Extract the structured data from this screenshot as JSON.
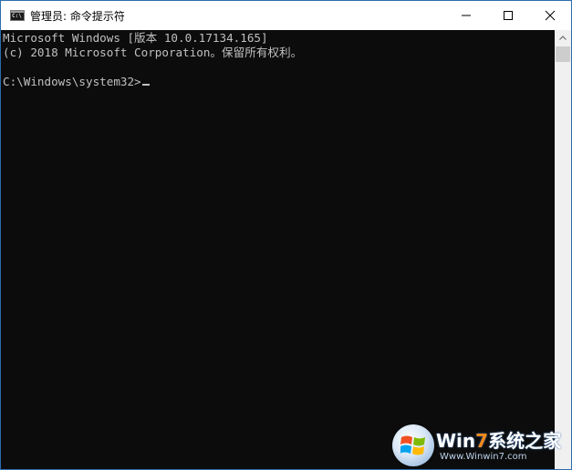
{
  "window": {
    "title": "管理员: 命令提示符",
    "icon": "cmd-icon",
    "icon_text": "C:\\"
  },
  "caption_buttons": {
    "minimize_icon": "minimize-icon",
    "maximize_icon": "maximize-icon",
    "close_icon": "close-icon"
  },
  "console": {
    "line1": "Microsoft Windows [版本 10.0.17134.165]",
    "line2": "(c) 2018 Microsoft Corporation。保留所有权利。",
    "prompt": "C:\\Windows\\system32>"
  },
  "scrollbar": {
    "up_icon": "scroll-up-arrow-icon"
  },
  "watermark": {
    "brand_prefix": "Win",
    "brand_seven": "7",
    "brand_suffix": "系统之家",
    "url": "Www.Winwin7.com"
  },
  "colors": {
    "console_bg": "#0c0c0c",
    "console_text": "#c0c0c0",
    "titlebar_bg": "#ffffff",
    "window_border": "#2b6cb0"
  }
}
